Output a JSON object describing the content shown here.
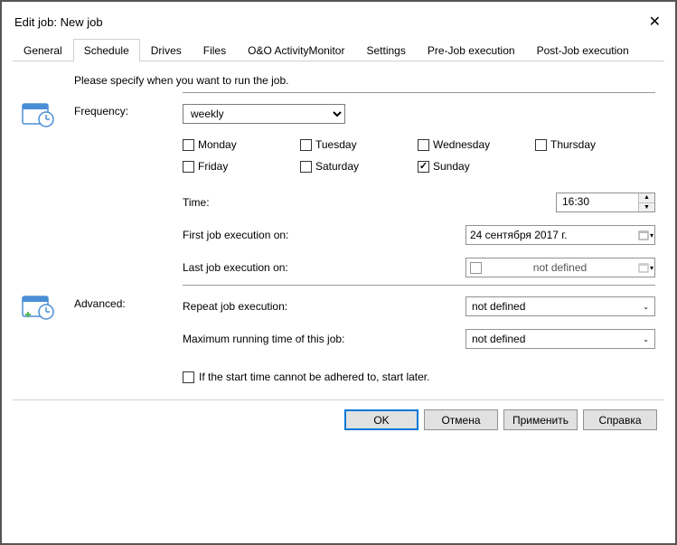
{
  "title": "Edit job: New job",
  "tabs": [
    "General",
    "Schedule",
    "Drives",
    "Files",
    "O&O ActivityMonitor",
    "Settings",
    "Pre-Job execution",
    "Post-Job execution"
  ],
  "activeTab": 1,
  "intro": "Please specify when you want to run the job.",
  "labels": {
    "frequency": "Frequency:",
    "advanced": "Advanced:"
  },
  "frequency_value": "weekly",
  "days": {
    "monday": {
      "label": "Monday",
      "checked": false
    },
    "tuesday": {
      "label": "Tuesday",
      "checked": false
    },
    "wednesday": {
      "label": "Wednesday",
      "checked": false
    },
    "thursday": {
      "label": "Thursday",
      "checked": false
    },
    "friday": {
      "label": "Friday",
      "checked": false
    },
    "saturday": {
      "label": "Saturday",
      "checked": false
    },
    "sunday": {
      "label": "Sunday",
      "checked": true
    }
  },
  "fields": {
    "time_label": "Time:",
    "time_value": "16:30",
    "first_label": "First job execution on:",
    "first_value": "24 сентября 2017 г.",
    "last_label": "Last job execution on:",
    "last_value": "not defined",
    "repeat_label": "Repeat job execution:",
    "repeat_value": "not defined",
    "maxrun_label": "Maximum running time of this job:",
    "maxrun_value": "not defined"
  },
  "start_later": "If the start time cannot be adhered to, start later.",
  "buttons": {
    "ok": "OK",
    "cancel": "Отмена",
    "apply": "Применить",
    "help": "Справка"
  }
}
